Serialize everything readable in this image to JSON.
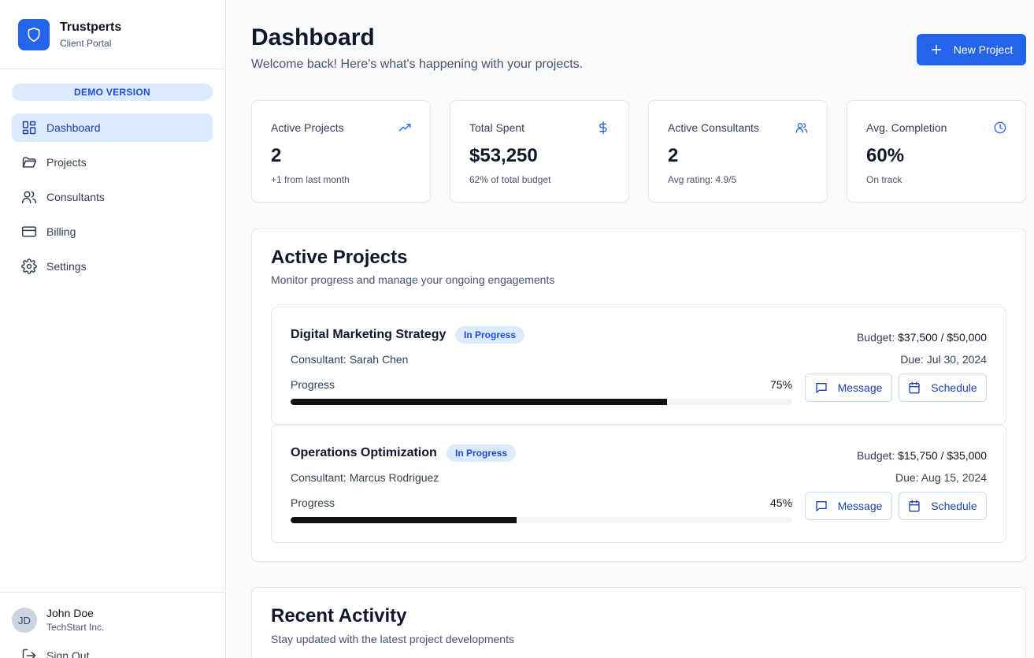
{
  "brand": {
    "name": "Trustperts",
    "subtitle": "Client Portal"
  },
  "sidebar": {
    "demo_badge": "DEMO VERSION",
    "items": [
      {
        "label": "Dashboard",
        "icon": "dashboard-icon",
        "active": true
      },
      {
        "label": "Projects",
        "icon": "folder-icon",
        "active": false
      },
      {
        "label": "Consultants",
        "icon": "users-icon",
        "active": false
      },
      {
        "label": "Billing",
        "icon": "credit-card-icon",
        "active": false
      },
      {
        "label": "Settings",
        "icon": "gear-icon",
        "active": false
      }
    ],
    "user": {
      "initials": "JD",
      "name": "John Doe",
      "company": "TechStart Inc."
    },
    "sign_out": "Sign Out"
  },
  "header": {
    "title": "Dashboard",
    "subtitle": "Welcome back! Here's what's happening with your projects.",
    "new_project_label": "New Project"
  },
  "stats": [
    {
      "label": "Active Projects",
      "value": "2",
      "note": "+1 from last month",
      "icon": "trending-up-icon"
    },
    {
      "label": "Total Spent",
      "value": "$53,250",
      "note": "62% of total budget",
      "icon": "dollar-icon"
    },
    {
      "label": "Active Consultants",
      "value": "2",
      "note": "Avg rating: 4.9/5",
      "icon": "users-icon"
    },
    {
      "label": "Avg. Completion",
      "value": "60%",
      "note": "On track",
      "icon": "clock-icon"
    }
  ],
  "active_projects": {
    "title": "Active Projects",
    "subtitle": "Monitor progress and manage your ongoing engagements",
    "projects": [
      {
        "name": "Digital Marketing Strategy",
        "status": "In Progress",
        "consultant": "Consultant: Sarah Chen",
        "budget_label": "Budget:",
        "budget_value": "$37,500 / $50,000",
        "due": "Due: Jul 30, 2024",
        "progress_label": "Progress",
        "progress_text": "75%",
        "progress": 0.75,
        "message_label": "Message",
        "schedule_label": "Schedule"
      },
      {
        "name": "Operations Optimization",
        "status": "In Progress",
        "consultant": "Consultant: Marcus Rodriguez",
        "budget_label": "Budget:",
        "budget_value": "$15,750 / $35,000",
        "due": "Due: Aug 15, 2024",
        "progress_label": "Progress",
        "progress_text": "45%",
        "progress": 0.45,
        "message_label": "Message",
        "schedule_label": "Schedule"
      }
    ]
  },
  "recent_activity": {
    "title": "Recent Activity",
    "subtitle": "Stay updated with the latest project developments"
  },
  "colors": {
    "primary": "#2563eb",
    "badge_bg": "#dbeafe",
    "badge_text": "#1d4ed8",
    "progress": "#111111"
  }
}
